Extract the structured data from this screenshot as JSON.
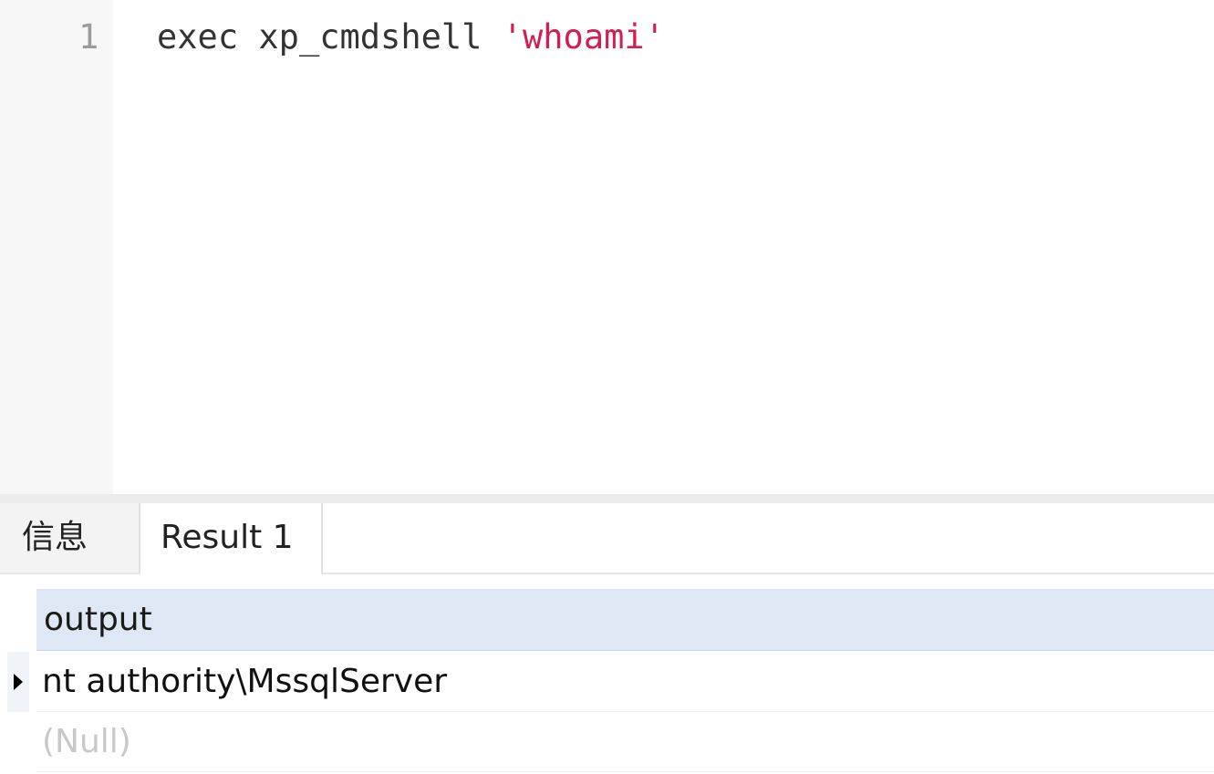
{
  "editor": {
    "line_numbers": [
      "1"
    ],
    "code": {
      "keyword": "exec",
      "function": "xp_cmdshell",
      "string": "'whoami'"
    },
    "string_color": "#d21e52"
  },
  "tabs": [
    {
      "label": "信息"
    },
    {
      "label": "Result 1"
    }
  ],
  "grid": {
    "columns": [
      "output"
    ],
    "rows": [
      [
        "nt authority\\MssqlServer"
      ],
      [
        "(Null)"
      ]
    ],
    "current_row_icon": "row-pointer-icon",
    "header_color": "#dde8f4"
  }
}
